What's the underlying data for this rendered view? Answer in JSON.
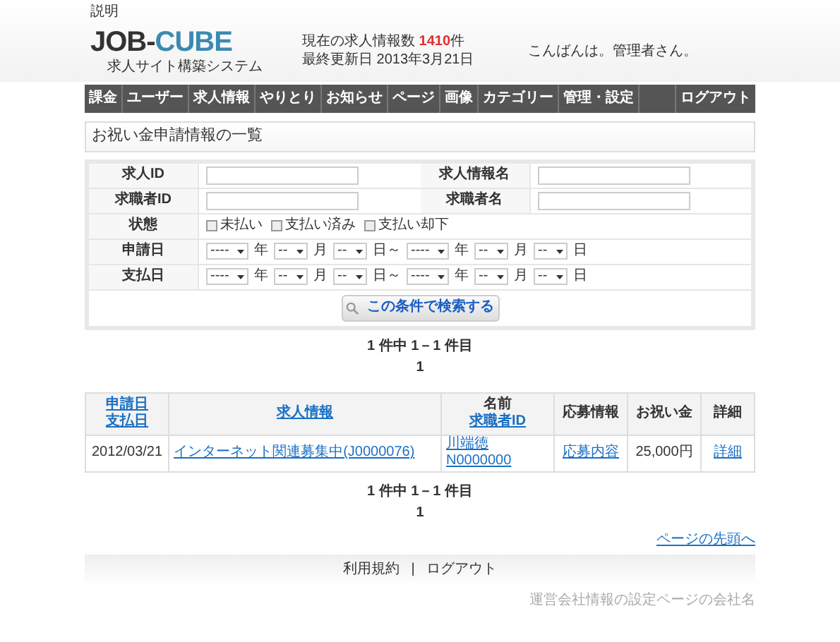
{
  "top_link": "説明",
  "logo": {
    "title_a": "JOB-",
    "title_b": "CUBE",
    "subtitle": "求人サイト構築システム"
  },
  "stats": {
    "count_label": "現在の求人情報数",
    "count": "1410",
    "count_unit": "件",
    "updated_label": "最終更新日",
    "updated": "2013年3月21日"
  },
  "greeting": "こんばんは。管理者さん。",
  "nav": [
    {
      "label": "課金"
    },
    {
      "label": "ユーザー"
    },
    {
      "label": "求人情報"
    },
    {
      "label": "やりとり"
    },
    {
      "label": "お知らせ"
    },
    {
      "label": "ページ"
    },
    {
      "label": "画像"
    },
    {
      "label": "カテゴリー"
    },
    {
      "label": "管理・設定"
    },
    {
      "kind": "blank"
    },
    {
      "label": "ログアウト"
    }
  ],
  "page_title": "お祝い金申請情報の一覧",
  "form": {
    "text_rows": [
      [
        {
          "label": "求人ID"
        },
        {
          "label": "求人情報名"
        }
      ],
      [
        {
          "label": "求職者ID"
        },
        {
          "label": "求職者名"
        }
      ]
    ],
    "status": {
      "label": "状態",
      "options": [
        {
          "label": "未払い",
          "checked": false
        },
        {
          "label": "支払い済み",
          "checked": false
        },
        {
          "label": "支払い却下",
          "checked": false
        }
      ]
    },
    "date_rows": [
      {
        "label": "申請日",
        "parts": [
          {
            "value": "----",
            "unit": "年"
          },
          {
            "value": "--",
            "unit": "月"
          },
          {
            "value": "--",
            "unit": "日～"
          },
          {
            "value": "----",
            "unit": "年"
          },
          {
            "value": "--",
            "unit": "月"
          },
          {
            "value": "--",
            "unit": "日"
          }
        ]
      },
      {
        "label": "支払日",
        "parts": [
          {
            "value": "----",
            "unit": "年"
          },
          {
            "value": "--",
            "unit": "月"
          },
          {
            "value": "--",
            "unit": "日～"
          },
          {
            "value": "----",
            "unit": "年"
          },
          {
            "value": "--",
            "unit": "月"
          },
          {
            "value": "--",
            "unit": "日"
          }
        ]
      }
    ],
    "search_button": "この条件で検索する"
  },
  "pager_top": {
    "summary": "1 件中 1－1 件目",
    "page": "1"
  },
  "table": {
    "columns": [
      {
        "lines": [
          {
            "text": "申請日",
            "link": true
          },
          {
            "text": "支払日",
            "link": true
          }
        ]
      },
      {
        "lines": [
          {
            "text": "求人情報",
            "link": true
          }
        ]
      },
      {
        "lines": [
          {
            "text": "名前",
            "link": false
          },
          {
            "text": "求職者ID",
            "link": true
          }
        ]
      },
      {
        "lines": [
          {
            "text": "応募情報",
            "link": false
          }
        ]
      },
      {
        "lines": [
          {
            "text": "お祝い金",
            "link": false
          }
        ]
      },
      {
        "lines": [
          {
            "text": "詳細",
            "link": false
          }
        ]
      }
    ],
    "rows": [
      {
        "date": "2012/03/21",
        "job": "インターネット関連募集中(J0000076)",
        "name": "川端徳",
        "seeker_id": "N0000000",
        "apply": "応募内容",
        "amount": "25,000円",
        "detail": "詳細"
      }
    ]
  },
  "pager_bottom": {
    "summary": "1 件中 1－1 件目",
    "page": "1"
  },
  "back_to_top": "ページの先頭へ",
  "footer_links": [
    "利用規約",
    "ログアウト"
  ],
  "footer_separator": "|",
  "company": "運営会社情報の設定ページの会社名"
}
